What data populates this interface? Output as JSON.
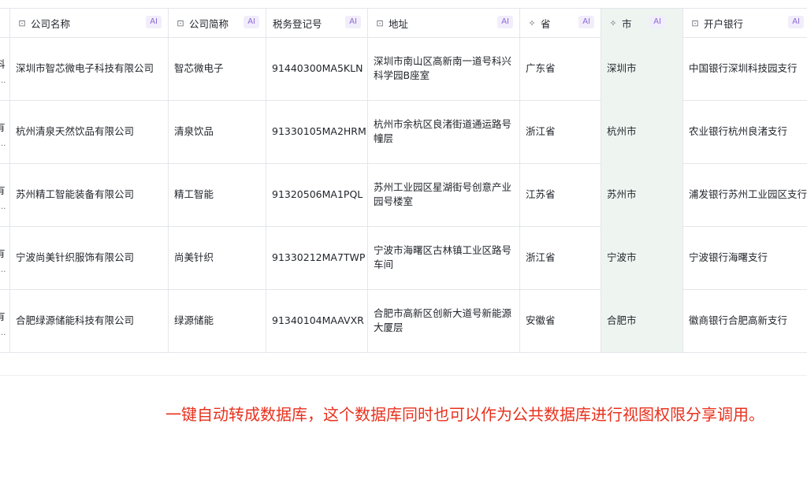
{
  "columns": [
    {
      "label": "公司名称",
      "icon": "ai-text-field-icon",
      "ai": "AI"
    },
    {
      "label": "公司简称",
      "icon": "ai-text-field-icon",
      "ai": "AI"
    },
    {
      "label": "税务登记号",
      "icon": "",
      "ai": "AI"
    },
    {
      "label": "地址",
      "icon": "ai-text-field-icon",
      "ai": "AI"
    },
    {
      "label": "省",
      "icon": "ai-tag-field-icon",
      "ai": "AI"
    },
    {
      "label": "市",
      "icon": "ai-tag-field-icon",
      "ai": "AI"
    },
    {
      "label": "开户银行",
      "icon": "ai-text-field-icon",
      "ai": "AI"
    }
  ],
  "rows": [
    {
      "cut": "科",
      "name": "深圳市智芯微电子科技有限公司",
      "short": "智芯微电子",
      "tax": "91440300MA5KLN",
      "addr": "深圳市南山区高新南一道号科兴科学园B座室",
      "prov": "广东省",
      "city": "深圳市",
      "bank": "中国银行深圳科技园支行"
    },
    {
      "cut": "有",
      "name": "杭州清泉天然饮品有限公司",
      "short": "清泉饮品",
      "tax": "91330105MA2HRM",
      "addr": "杭州市余杭区良渚街道通运路号幢层",
      "prov": "浙江省",
      "city": "杭州市",
      "bank": "农业银行杭州良渚支行"
    },
    {
      "cut": "有",
      "name": "苏州精工智能装备有限公司",
      "short": "精工智能",
      "tax": "91320506MA1PQL",
      "addr": "苏州工业园区星湖街号创意产业园号楼室",
      "prov": "江苏省",
      "city": "苏州市",
      "bank": "浦发银行苏州工业园区支行"
    },
    {
      "cut": "有",
      "name": "宁波尚美针织服饰有限公司",
      "short": "尚美针织",
      "tax": "91330212MA7TWP",
      "addr": "宁波市海曙区古林镇工业区路号车间",
      "prov": "浙江省",
      "city": "宁波市",
      "bank": "宁波银行海曙支行"
    },
    {
      "cut": "有",
      "name": "合肥绿源储能科技有限公司",
      "short": "绿源储能",
      "tax": "91340104MAAVXR",
      "addr": "合肥市高新区创新大道号新能源大厦层",
      "prov": "安徽省",
      "city": "合肥市",
      "bank": "徽商银行合肥高新支行"
    }
  ],
  "caption": "一键自动转成数据库，这个数据库同时也可以作为公共数据库进行视图权限分享调用。",
  "colors": {
    "caption": "#e8301c",
    "highlight": "#eef5f1",
    "ai_badge": "#8a68d6"
  }
}
